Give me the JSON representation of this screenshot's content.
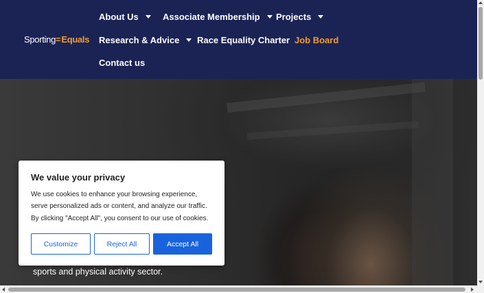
{
  "header": {
    "logo": {
      "part1": "Sporting",
      "mark": "=",
      "part2": "Equals"
    },
    "nav": [
      {
        "label": "About Us",
        "has_caret": true
      },
      {
        "label": "Associate Membership",
        "has_caret": true
      },
      {
        "label": "Projects",
        "has_caret": true
      },
      {
        "label": "Research & Advice",
        "has_caret": true
      },
      {
        "label": "Race Equality Charter",
        "has_caret": false
      },
      {
        "label": "Job Board",
        "has_caret": false,
        "active": true
      },
      {
        "label": "Contact us",
        "has_caret": false
      }
    ]
  },
  "hero": {
    "text": "sports and physical activity sector."
  },
  "cookie_banner": {
    "title": "We value your privacy",
    "lines": [
      "We use cookies to enhance your browsing experience,",
      "serve personalized ads or content, and analyze our traffic.",
      "By clicking \"Accept All\", you consent to our use of cookies."
    ],
    "buttons": {
      "customize": "Customize",
      "reject": "Reject All",
      "accept": "Accept All"
    }
  },
  "colors": {
    "header_bg": "#1b2354",
    "accent_orange": "#f39c2b",
    "button_blue": "#1863dc"
  }
}
